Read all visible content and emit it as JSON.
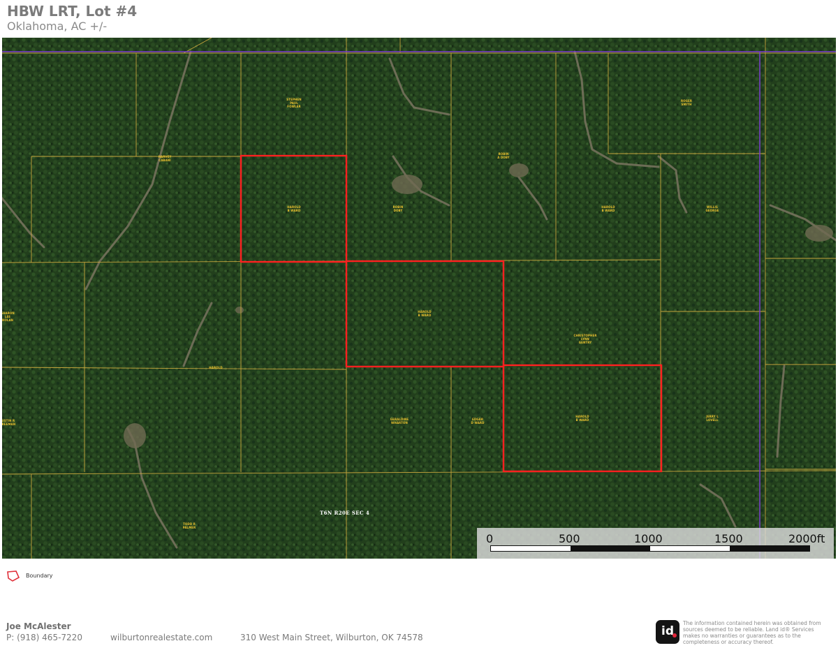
{
  "header": {
    "title": "HBW LRT, Lot #4",
    "subtitle": "Oklahoma,  AC +/-"
  },
  "map": {
    "colors": {
      "forest": "#1f3d1a",
      "parcel_line": "#d8b040",
      "boundary": "#ff2020",
      "section_line": "#7a3cd0",
      "owner_label": "#e8c030",
      "clearing": "#7a7460"
    },
    "section_label": "T6N R20E SEC 4",
    "owners": [
      {
        "label": "STEPHEN\nPAUL\nFOWLER"
      },
      {
        "label": "HARVEY\nCABANI"
      },
      {
        "label": "ROGER\nSMITH"
      },
      {
        "label": "ROBIN\nA DOBY"
      },
      {
        "label": "HAROLD\nB WARD"
      },
      {
        "label": "ROBIN\nDOBY"
      },
      {
        "label": "HAROLD\nB WARD"
      },
      {
        "label": "WILLIS\nGEORGE"
      },
      {
        "label": "SHARON\nLEE\nNOLAN"
      },
      {
        "label": "HAROLD\nB WARD"
      },
      {
        "label": "CHRISTOPHER\nLYNN\nGENTRY"
      },
      {
        "label": "HAROLD"
      },
      {
        "label": "GERALDINE\nWHARTON"
      },
      {
        "label": "EDGAR\nD WARD"
      },
      {
        "label": "HAROLD\nB WARD"
      },
      {
        "label": "JERRY L\nLOVELL"
      },
      {
        "label": "JUSTIN R\nFREEMAN"
      },
      {
        "label": "TODD R\nPALMER"
      }
    ],
    "scale_bar": {
      "ticks": [
        "0",
        "500",
        "1000",
        "1500",
        "2000ft"
      ]
    }
  },
  "legend": {
    "items": [
      {
        "icon": "boundary-polygon-icon",
        "label": "Boundary"
      }
    ]
  },
  "footer": {
    "agent_name": "Joe McAlester",
    "phone": "P: (918) 465-7220",
    "website": "wilburtonrealestate.com",
    "address": "310 West Main Street, Wilburton, OK 74578",
    "logo_text": "id",
    "disclaimer": "The information contained herein was obtained from sources deemed to be reliable. Land id® Services makes no warranties or guarantees as to the completeness or accuracy thereof."
  }
}
